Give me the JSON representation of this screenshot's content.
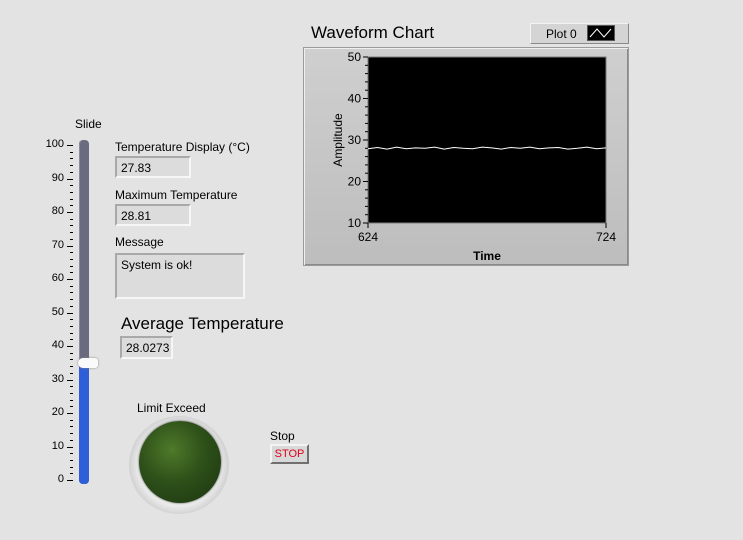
{
  "slide": {
    "label": "Slide",
    "ticks": [
      "100",
      "90",
      "80",
      "70",
      "60",
      "50",
      "40",
      "30",
      "20",
      "10",
      "0"
    ],
    "min": 0,
    "max": 100,
    "value": 35
  },
  "temperature_display": {
    "label": "Temperature Display (°C)",
    "value": "27.83"
  },
  "maximum_temperature": {
    "label": "Maximum Temperature",
    "value": "28.81"
  },
  "message": {
    "label": "Message",
    "value": "System is ok!"
  },
  "average_temperature": {
    "label": "Average Temperature",
    "value": "28.0273"
  },
  "limit_exceed": {
    "label": "Limit Exceed",
    "state": "off",
    "color_off": "#2a4a1a"
  },
  "stop": {
    "label": "Stop",
    "button_text": "STOP"
  },
  "chart": {
    "title": "Waveform Chart",
    "legend_plot_name": "Plot 0",
    "xlabel": "Time",
    "ylabel": "Amplitude",
    "x_ticks": [
      "624",
      "724"
    ],
    "y_ticks": [
      "50",
      "40",
      "30",
      "20",
      "10"
    ],
    "background": "#000000",
    "line_color": "#ffffff"
  },
  "chart_data": {
    "type": "line",
    "title": "Waveform Chart",
    "xlabel": "Time",
    "ylabel": "Amplitude",
    "xlim": [
      624,
      724
    ],
    "ylim": [
      10,
      50
    ],
    "grid": false,
    "legend_position": "top-right",
    "series": [
      {
        "name": "Plot 0",
        "x": [
          624,
          628,
          632,
          636,
          640,
          644,
          648,
          652,
          656,
          660,
          664,
          668,
          672,
          676,
          680,
          684,
          688,
          692,
          696,
          700,
          704,
          708,
          712,
          716,
          720,
          724
        ],
        "values": [
          27.9,
          28.2,
          27.8,
          28.3,
          27.9,
          28.1,
          28.0,
          28.3,
          27.8,
          28.2,
          28.0,
          27.9,
          28.3,
          28.1,
          27.8,
          28.2,
          28.0,
          28.3,
          27.9,
          28.1,
          28.2,
          27.8,
          28.0,
          28.3,
          27.9,
          28.1
        ]
      }
    ]
  }
}
